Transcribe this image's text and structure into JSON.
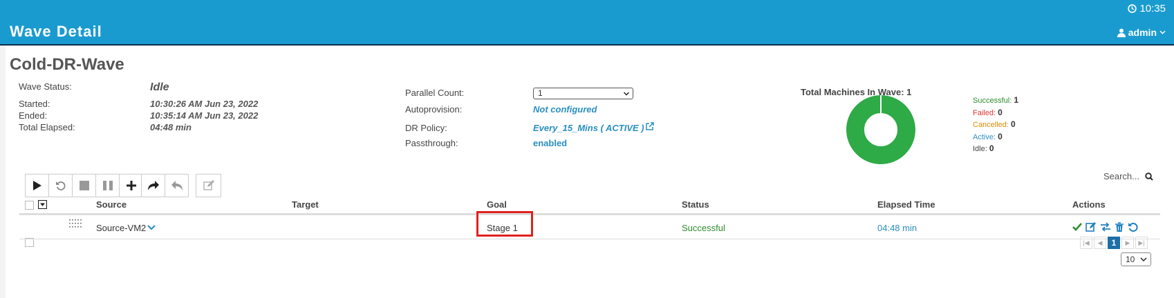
{
  "header": {
    "time": "10:35",
    "title": "Wave Detail",
    "user": "admin"
  },
  "wave": {
    "name": "Cold-DR-Wave",
    "status_label": "Wave Status:",
    "status": "Idle",
    "started_label": "Started:",
    "started": "10:30:26 AM Jun 23, 2022",
    "ended_label": "Ended:",
    "ended": "10:35:14 AM Jun 23, 2022",
    "elapsed_label": "Total Elapsed:",
    "elapsed": "04:48 min",
    "parallel_label": "Parallel Count:",
    "parallel_value": "1",
    "autoprov_label": "Autoprovision:",
    "autoprov_value": "Not configured",
    "policy_label": "DR Policy:",
    "policy_value": "Every_15_Mins ( ACTIVE )",
    "passthrough_label": "Passthrough:",
    "passthrough_value": "enabled"
  },
  "summary": {
    "title": "Total Machines In Wave: 1",
    "donut_color": "#2eaa46",
    "legend": [
      {
        "label": "Successful:",
        "count": "1",
        "color": "#2e8b2e"
      },
      {
        "label": "Failed:",
        "count": "0",
        "color": "#d33"
      },
      {
        "label": "Cancelled:",
        "count": "0",
        "color": "#e08a00"
      },
      {
        "label": "Active:",
        "count": "0",
        "color": "#2a8fc0"
      },
      {
        "label": "Idle:",
        "count": "0",
        "color": "#444"
      }
    ]
  },
  "toolbar": {
    "buttons": [
      "play-icon",
      "restart-icon",
      "stop-icon",
      "pause-icon",
      "plus-icon",
      "forward-icon",
      "undo-icon",
      "edit-icon"
    ]
  },
  "search": {
    "placeholder": "Search..."
  },
  "table": {
    "columns": {
      "source": "Source",
      "target": "Target",
      "goal": "Goal",
      "status": "Status",
      "elapsed": "Elapsed Time",
      "actions": "Actions"
    },
    "rows": [
      {
        "source": "Source-VM2",
        "target": "",
        "goal": "Stage 1",
        "status": "Successful",
        "elapsed": "04:48 min"
      }
    ]
  },
  "pagination": {
    "current": "1",
    "page_size": "10"
  }
}
